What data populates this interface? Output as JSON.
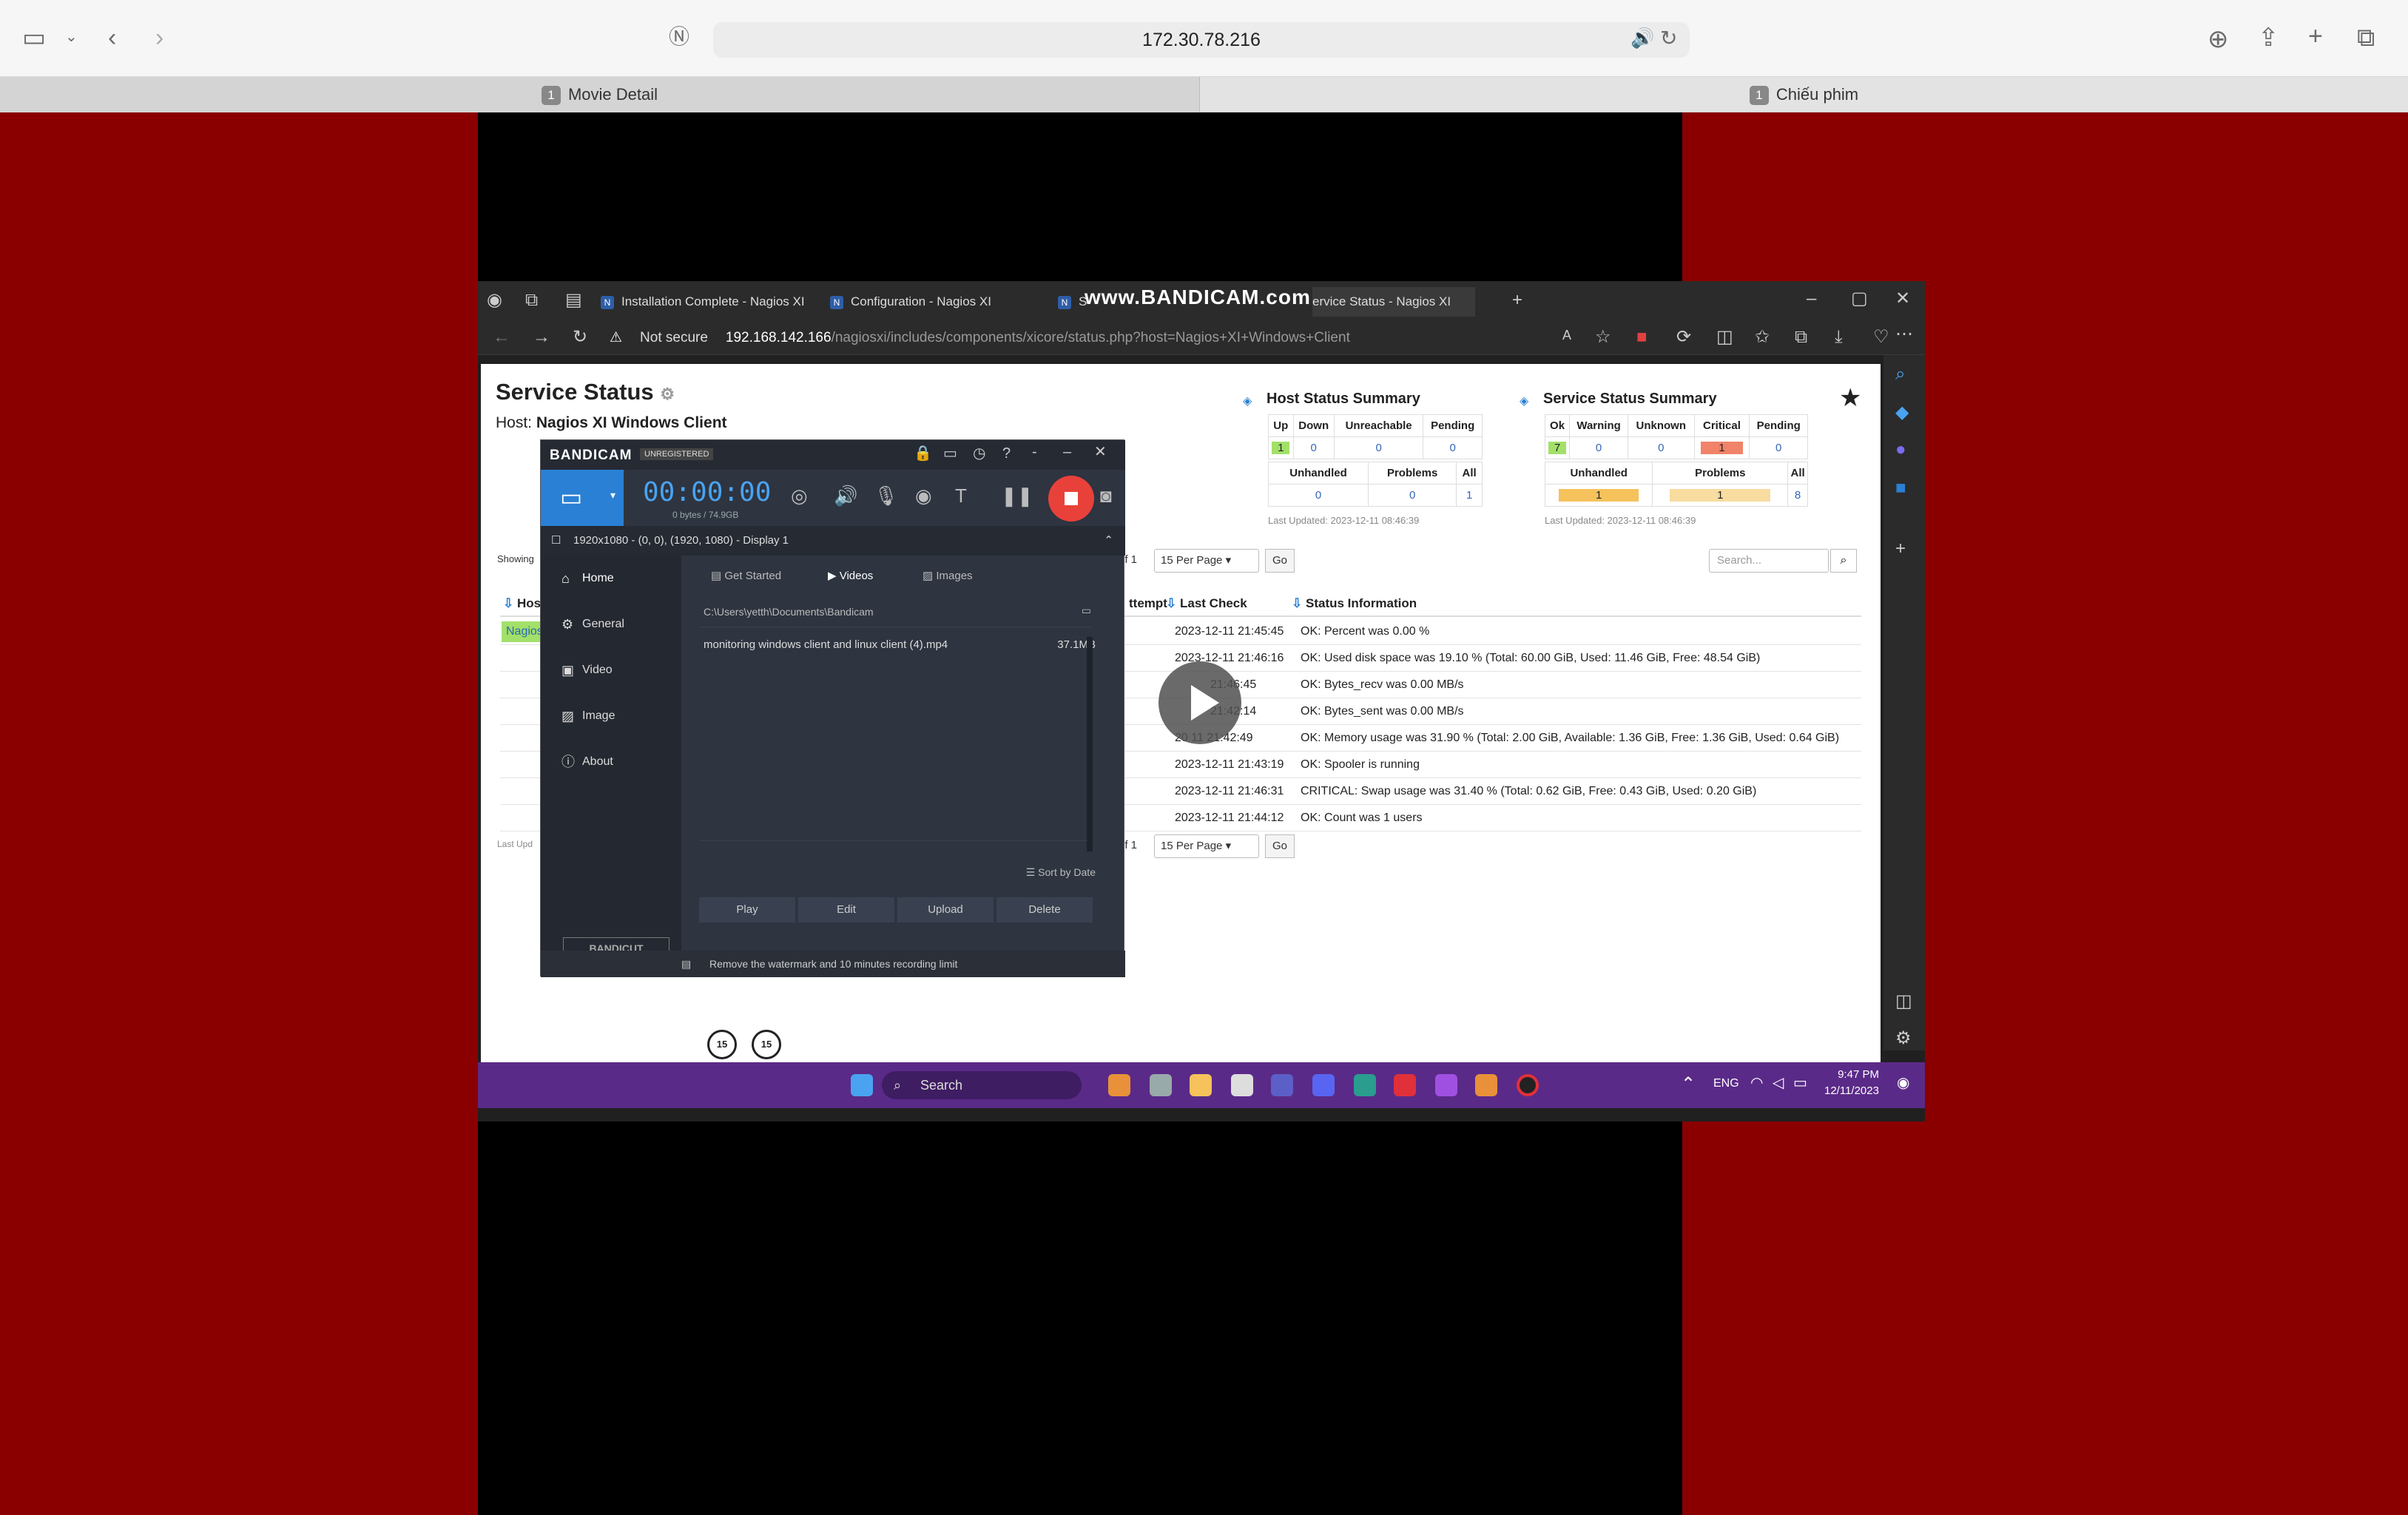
{
  "safari": {
    "url": "172.30.78.216",
    "tabs": [
      {
        "num": "1",
        "label": "Movie Detail"
      },
      {
        "num": "1",
        "label": "Chiếu phim"
      }
    ]
  },
  "edge": {
    "tabs": [
      {
        "label": "Installation Complete - Nagios XI"
      },
      {
        "label": "Configuration - Nagios XI"
      },
      {
        "label": "S"
      },
      {
        "label": "ervice Status - Nagios XI"
      }
    ],
    "watermark": "www.BANDICAM.com",
    "not_secure": "Not secure",
    "url_host": "192.168.142.166",
    "url_path": "/nagiosxi/includes/components/xicore/status.php?host=Nagios+XI+Windows+Client"
  },
  "nagios": {
    "title": "Service Status",
    "host_label": "Host:",
    "host_name": "Nagios XI Windows Client",
    "host_summary": {
      "title": "Host Status Summary",
      "headers1": [
        "Up",
        "Down",
        "Unreachable",
        "Pending"
      ],
      "values1": [
        "1",
        "0",
        "0",
        "0"
      ],
      "headers2": [
        "Unhandled",
        "Problems",
        "All"
      ],
      "values2": [
        "0",
        "0",
        "1"
      ],
      "updated": "Last Updated: 2023-12-11 08:46:39"
    },
    "service_summary": {
      "title": "Service Status Summary",
      "headers1": [
        "Ok",
        "Warning",
        "Unknown",
        "Critical",
        "Pending"
      ],
      "values1": [
        "7",
        "0",
        "0",
        "1",
        "0"
      ],
      "headers2": [
        "Unhandled",
        "Problems",
        "All"
      ],
      "values2": [
        "1",
        "1",
        "8"
      ],
      "updated": "Last Updated: 2023-12-11 08:46:39"
    },
    "per_page": "15 Per Page",
    "go": "Go",
    "of_text": "of 1",
    "search_placeholder": "Search...",
    "showing": "Showing",
    "last_upd": "Last Upd",
    "col_host": "Host",
    "col_attempt": "ttempt",
    "col_last_check": "Last Check",
    "col_status": "Status Information",
    "host_cell": "Nagios",
    "rows": [
      {
        "check": "2023-12-11 21:45:45",
        "status": "OK: Percent was 0.00 %"
      },
      {
        "check": "2023-12-11 21:46:16",
        "status": "OK: Used disk space was 19.10 % (Total: 60.00 GiB, Used: 11.46 GiB, Free: 48.54 GiB)"
      },
      {
        "check": "21:46:45",
        "status": "OK: Bytes_recv was 0.00 MB/s"
      },
      {
        "check": "21:42:14",
        "status": "OK: Bytes_sent was 0.00 MB/s"
      },
      {
        "check": "20 11 21:42:49",
        "status": "OK: Memory usage was 31.90 % (Total: 2.00 GiB, Available: 1.36 GiB, Free: 1.36 GiB, Used: 0.64 GiB)"
      },
      {
        "check": "2023-12-11 21:43:19",
        "status": "OK: Spooler is running"
      },
      {
        "check": "2023-12-11 21:46:31",
        "status": "CRITICAL: Swap usage was 31.40 % (Total: 0.62 GiB, Free: 0.43 GiB, Used: 0.20 GiB)"
      },
      {
        "check": "2023-12-11 21:44:12",
        "status": "OK: Count was 1 users"
      }
    ]
  },
  "bandicam": {
    "logo": "BANDICAM",
    "unregistered": "UNREGISTERED",
    "timer": "00:00:00",
    "bytes": "0 bytes / 74.9GB",
    "display": "1920x1080 - (0, 0), (1920, 1080) - Display 1",
    "nav": [
      "Home",
      "General",
      "Video",
      "Image",
      "About"
    ],
    "bandicut": "BANDICUT",
    "tabs": [
      "Get Started",
      "Videos",
      "Images"
    ],
    "path": "C:\\Users\\yetth\\Documents\\Bandicam",
    "file_name": "monitoring windows client and linux client (4).mp4",
    "file_size": "37.1MB",
    "sort": "Sort by Date",
    "actions": [
      "Play",
      "Edit",
      "Upload",
      "Delete"
    ],
    "footer": "Remove the watermark and 10 minutes recording limit"
  },
  "player": {
    "rewind": "15",
    "forward": "15"
  },
  "taskbar": {
    "search": "Search",
    "lang": "ENG",
    "time": "9:47 PM",
    "date": "12/11/2023"
  }
}
